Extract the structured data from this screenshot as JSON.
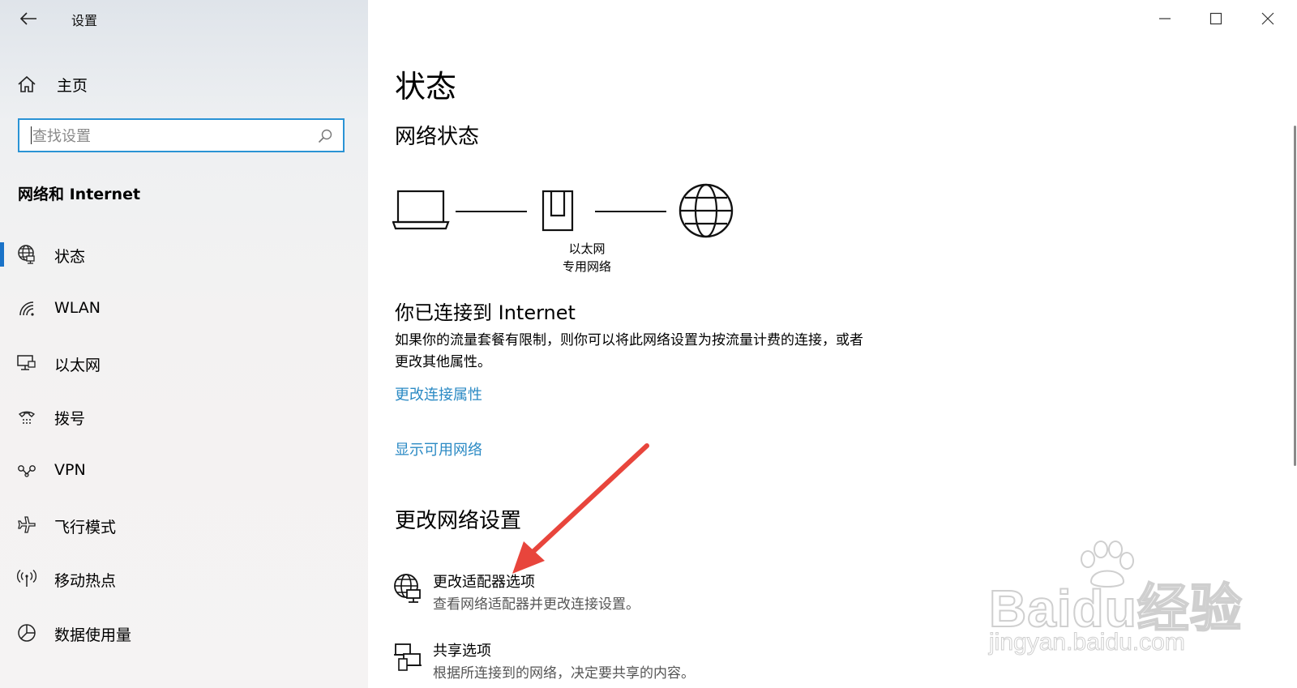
{
  "app": {
    "title": "设置"
  },
  "sidebar": {
    "home_label": "主页",
    "search_placeholder": "查找设置",
    "section_title": "网络和 Internet",
    "items": [
      {
        "label": "状态",
        "icon": "globe-icon",
        "selected": true
      },
      {
        "label": "WLAN",
        "icon": "wifi-icon",
        "selected": false
      },
      {
        "label": "以太网",
        "icon": "ethernet-icon",
        "selected": false
      },
      {
        "label": "拨号",
        "icon": "dialup-icon",
        "selected": false
      },
      {
        "label": "VPN",
        "icon": "vpn-icon",
        "selected": false
      },
      {
        "label": "飞行模式",
        "icon": "airplane-icon",
        "selected": false
      },
      {
        "label": "移动热点",
        "icon": "hotspot-icon",
        "selected": false
      },
      {
        "label": "数据使用量",
        "icon": "data-usage-icon",
        "selected": false
      }
    ]
  },
  "main": {
    "page_title": "状态",
    "network_status_title": "网络状态",
    "diagram": {
      "adapter_name": "以太网",
      "network_type": "专用网络"
    },
    "connected_title": "你已连接到 Internet",
    "connected_desc": "如果你的流量套餐有限制，则你可以将此网络设置为按流量计费的连接，或者更改其他属性。",
    "links": {
      "change_props": "更改连接属性",
      "show_networks": "显示可用网络"
    },
    "change_settings_title": "更改网络设置",
    "options": [
      {
        "title": "更改适配器选项",
        "desc": "查看网络适配器并更改连接设置。",
        "icon": "adapter-icon"
      },
      {
        "title": "共享选项",
        "desc": "根据所连接到的网络，决定要共享的内容。",
        "icon": "sharing-icon"
      }
    ]
  },
  "watermark": {
    "brand": "Baidu经验",
    "url": "jingyan.baidu.com"
  },
  "colors": {
    "accent": "#2a93d5",
    "link": "#2b8ac4",
    "selection_bar": "#1a73c8",
    "arrow": "#e8453c"
  }
}
